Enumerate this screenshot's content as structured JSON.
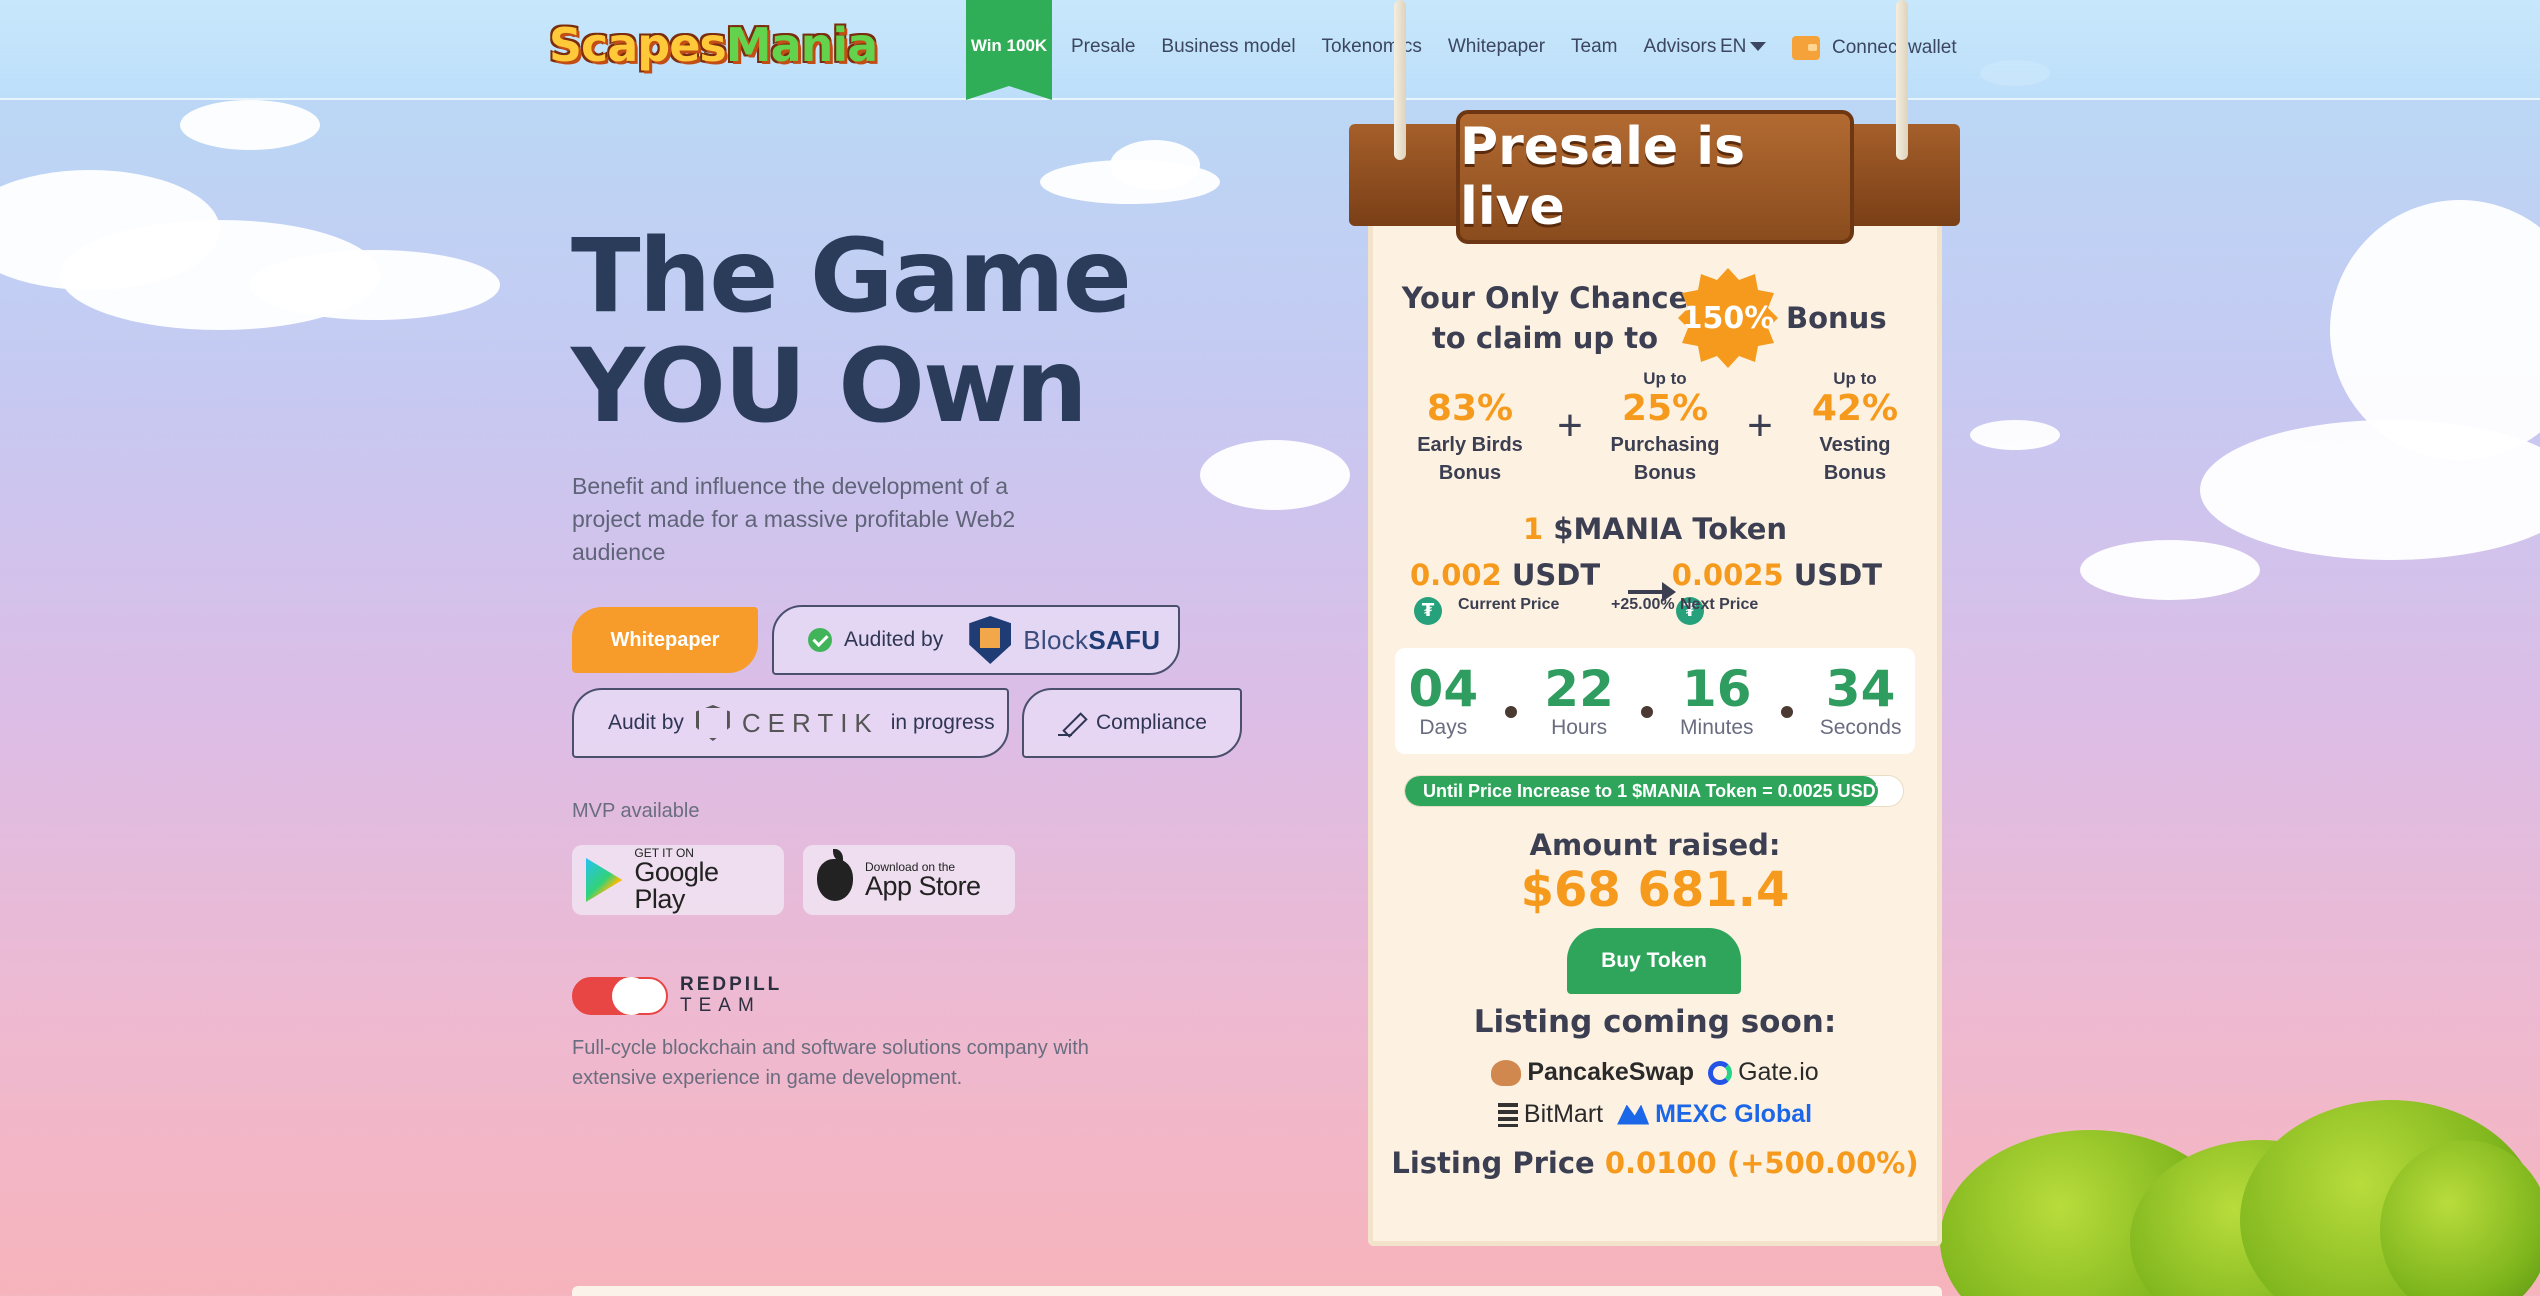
{
  "header": {
    "logo_text_a": "Scapes",
    "logo_text_b": "Mania",
    "win_badge": "Win 100K",
    "nav": [
      "Presale",
      "Business model",
      "Tokenomics",
      "Whitepaper",
      "Team",
      "Advisors"
    ],
    "language": "EN",
    "connect_wallet": "Connect wallet"
  },
  "hero": {
    "title_line1": "The Game",
    "title_line2": "YOU Own",
    "subtitle": "Benefit and influence the development of a project made for a massive profitable Web2 audience",
    "whitepaper_button": "Whitepaper",
    "audited_by": "Audited by",
    "blocksafu_a": "Block",
    "blocksafu_b": "SAFU",
    "audit_by": "Audit by",
    "certik": "CERTIK",
    "in_progress": "in progress",
    "compliance": "Compliance",
    "mvp_available": "MVP available",
    "google_play_small": "GET IT ON",
    "google_play_big": "Google Play",
    "app_store_small": "Download on the",
    "app_store_big": "App Store",
    "redpill_line1": "REDPILL",
    "redpill_line2": "TEAM",
    "redpill_desc": "Full-cycle blockchain and software solutions company with extensive experience in game development."
  },
  "presale": {
    "sign": "Presale is live",
    "chance_text": "Your Only Chance to claim up to",
    "bonus_badge": "150%",
    "bonus_word": "Bonus",
    "bonuses": [
      {
        "upto": "",
        "pct": "83%",
        "label": "Early Birds Bonus"
      },
      {
        "upto": "Up to",
        "pct": "25%",
        "label": "Purchasing Bonus"
      },
      {
        "upto": "Up to",
        "pct": "42%",
        "label": "Vesting Bonus"
      }
    ],
    "plus": "+",
    "token_one": "1",
    "token_name": "$MANIA Token",
    "current_price": "0.002",
    "next_price": "0.0025",
    "currency": "USDT",
    "tether_symbol": "₮",
    "current_price_label": "Current Price",
    "increase": "+25.00%",
    "next_price_label": "Next Price",
    "countdown": {
      "days": "04",
      "days_label": "Days",
      "hours": "22",
      "hours_label": "Hours",
      "minutes": "16",
      "minutes_label": "Minutes",
      "seconds": "34",
      "seconds_label": "Seconds"
    },
    "progress_text": "Until Price Increase to 1 $MANIA Token = 0.0025 USDT",
    "progress_fraction": 0.95,
    "amount_raised_label": "Amount raised:",
    "amount_raised": "$68 681.4",
    "buy_button": "Buy Token",
    "listing_title": "Listing coming soon:",
    "exchanges": [
      "PancakeSwap",
      "Gate.io",
      "BitMart",
      "MEXC Global"
    ],
    "listing_price_label": "Listing Price",
    "listing_price": "0.0100 (+500.00%)"
  },
  "colors": {
    "accent_orange": "#f59a1d",
    "accent_green": "#2fa55c",
    "title_navy": "#2b3b5a"
  }
}
